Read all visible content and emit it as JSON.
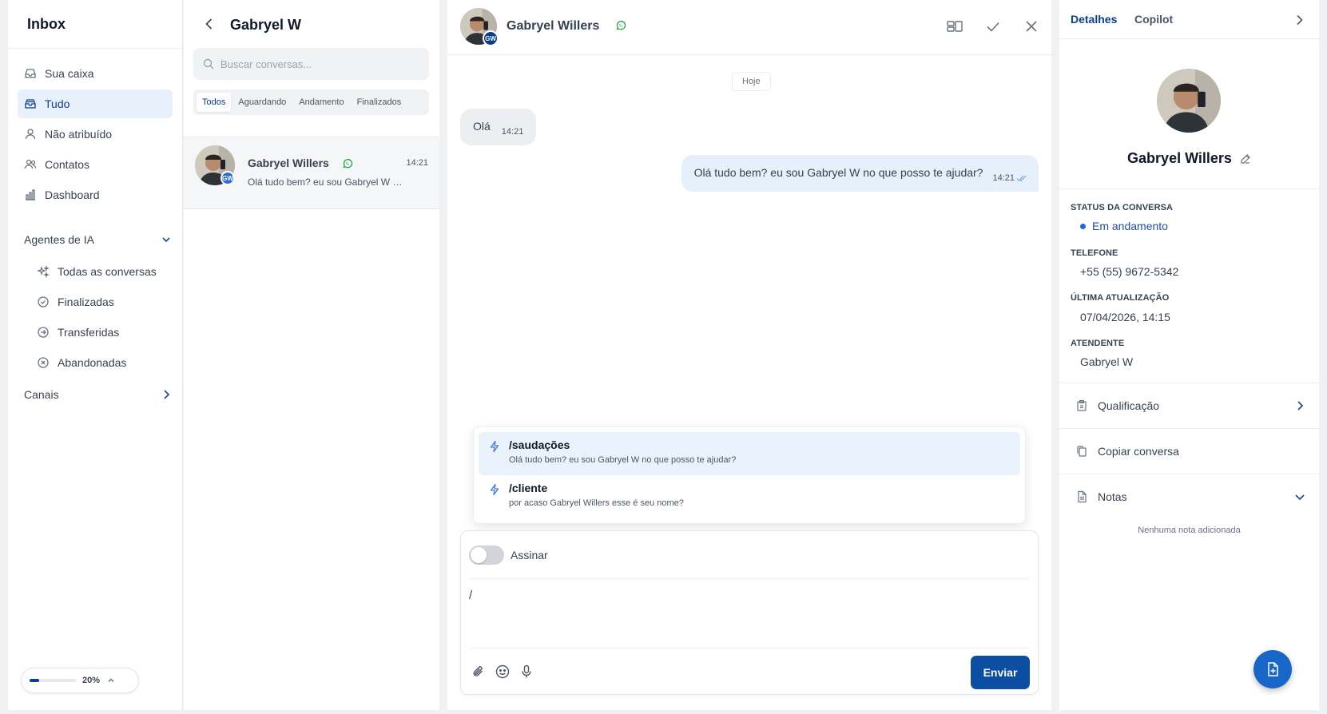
{
  "sidebar": {
    "title": "Inbox",
    "items": [
      {
        "label": "Sua caixa",
        "icon": "inbox-icon"
      },
      {
        "label": "Tudo",
        "icon": "inbox-stack-icon"
      },
      {
        "label": "Não atribuído",
        "icon": "user-icon"
      },
      {
        "label": "Contatos",
        "icon": "users-icon"
      },
      {
        "label": "Dashboard",
        "icon": "bar-chart-icon"
      }
    ],
    "ai_section": "Agentes de IA",
    "ai_items": [
      {
        "label": "Todas as conversas",
        "icon": "sparkles-icon"
      },
      {
        "label": "Finalizadas",
        "icon": "check-circle-icon"
      },
      {
        "label": "Transferidas",
        "icon": "arrow-circle-icon"
      },
      {
        "label": "Abandonadas",
        "icon": "x-circle-icon"
      }
    ],
    "channels_section": "Canais",
    "zoom": {
      "label": "20%",
      "value": 0.2
    }
  },
  "conversation_list": {
    "title": "Gabryel W",
    "search_placeholder": "Buscar conversas...",
    "tabs": [
      "Todos",
      "Aguardando",
      "Andamento",
      "Finalizados"
    ],
    "active_tab": "Todos",
    "conversations": [
      {
        "name": "Gabryel Willers",
        "time": "14:21",
        "preview": "Olá tudo bem? eu sou Gabryel W no que posso te ajudar?",
        "badge": "GW",
        "channel_icon": "whatsapp-icon"
      }
    ]
  },
  "chat": {
    "contact_name": "Gabryel Willers",
    "badge": "GW",
    "day_label": "Hoje",
    "messages": [
      {
        "direction": "in",
        "text": "Olá",
        "time": "14:21"
      },
      {
        "direction": "out",
        "text": "Olá tudo bem? eu sou Gabryel W no que posso te ajudar?",
        "time": "14:21"
      }
    ],
    "quick_replies": [
      {
        "command": "/saudações",
        "text": "Olá tudo bem? eu sou Gabryel W no que posso te ajudar?"
      },
      {
        "command": "/cliente",
        "text": "por acaso Gabryel Willers esse é seu nome?"
      }
    ],
    "composer": {
      "sign_label": "Assinar",
      "value": "/",
      "send_label": "Enviar"
    }
  },
  "details": {
    "tabs": [
      "Detalhes",
      "Copilot"
    ],
    "active_tab": "Detalhes",
    "name": "Gabryel Willers",
    "fields": {
      "status_label": "STATUS DA CONVERSA",
      "status_value": "Em andamento",
      "phone_label": "TELEFONE",
      "phone_value": "+55 (55) 9672-5342",
      "updated_label": "ÚLTIMA ATUALIZAÇÃO",
      "updated_value": "07/04/2026, 14:15",
      "agent_label": "ATENDENTE",
      "agent_value": "Gabryel W"
    },
    "actions": [
      "Qualificação",
      "Copiar conversa",
      "Notas"
    ],
    "notes_empty": "Nenhuma nota adicionada"
  },
  "colors": {
    "primary": "#0b4ea2",
    "accent_blue": "#1e4fa3",
    "whatsapp_green": "#25a244",
    "active_bg": "#e8f0fb"
  }
}
